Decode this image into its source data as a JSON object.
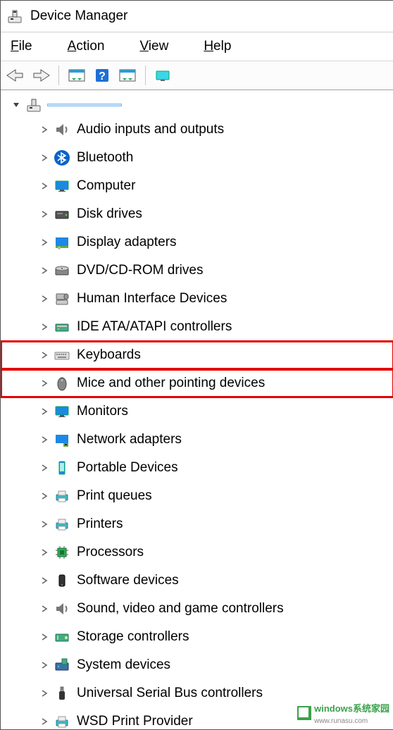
{
  "window": {
    "title": "Device Manager"
  },
  "menubar": {
    "file": "File",
    "action": "Action",
    "view": "View",
    "help": "Help"
  },
  "rootNode": {
    "label": ""
  },
  "categories": [
    {
      "key": "audio",
      "label": "Audio inputs and outputs",
      "icon": "speaker-icon",
      "hl": false
    },
    {
      "key": "bluetooth",
      "label": "Bluetooth",
      "icon": "bluetooth-icon",
      "hl": false
    },
    {
      "key": "computer",
      "label": "Computer",
      "icon": "monitor-icon",
      "hl": false
    },
    {
      "key": "disk",
      "label": "Disk drives",
      "icon": "disk-icon",
      "hl": false
    },
    {
      "key": "display",
      "label": "Display adapters",
      "icon": "display-adapter-icon",
      "hl": false
    },
    {
      "key": "dvd",
      "label": "DVD/CD-ROM drives",
      "icon": "optical-drive-icon",
      "hl": false
    },
    {
      "key": "hid",
      "label": "Human Interface Devices",
      "icon": "hid-icon",
      "hl": false
    },
    {
      "key": "ide",
      "label": "IDE ATA/ATAPI controllers",
      "icon": "ide-icon",
      "hl": false
    },
    {
      "key": "keyboard",
      "label": "Keyboards",
      "icon": "keyboard-icon",
      "hl": true
    },
    {
      "key": "mice",
      "label": "Mice and other pointing devices",
      "icon": "mouse-icon",
      "hl": true
    },
    {
      "key": "monitors",
      "label": "Monitors",
      "icon": "monitor2-icon",
      "hl": false
    },
    {
      "key": "network",
      "label": "Network adapters",
      "icon": "network-adapter-icon",
      "hl": false
    },
    {
      "key": "portable",
      "label": "Portable Devices",
      "icon": "portable-device-icon",
      "hl": false
    },
    {
      "key": "printq",
      "label": "Print queues",
      "icon": "print-queue-icon",
      "hl": false
    },
    {
      "key": "printers",
      "label": "Printers",
      "icon": "printer-icon",
      "hl": false
    },
    {
      "key": "cpu",
      "label": "Processors",
      "icon": "cpu-icon",
      "hl": false
    },
    {
      "key": "software",
      "label": "Software devices",
      "icon": "software-device-icon",
      "hl": false
    },
    {
      "key": "sound",
      "label": "Sound, video and game controllers",
      "icon": "sound-icon",
      "hl": false
    },
    {
      "key": "storage",
      "label": "Storage controllers",
      "icon": "storage-controller-icon",
      "hl": false
    },
    {
      "key": "system",
      "label": "System devices",
      "icon": "system-device-icon",
      "hl": false
    },
    {
      "key": "usb",
      "label": "Universal Serial Bus controllers",
      "icon": "usb-icon",
      "hl": false
    },
    {
      "key": "wsd",
      "label": "WSD Print Provider",
      "icon": "wsd-icon",
      "hl": false
    }
  ],
  "watermark": {
    "text": "windows系统家园",
    "url": "www.runasu.com"
  }
}
